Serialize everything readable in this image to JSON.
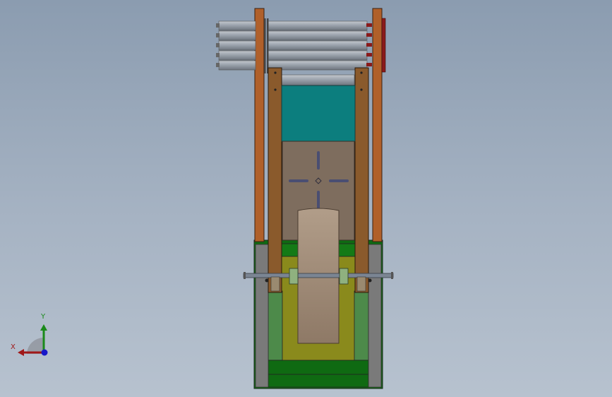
{
  "viewport": {
    "background_top": "#8b9cb0",
    "background_bottom": "#b7c2cf"
  },
  "model": {
    "colors": {
      "roller_gray": "#9aa2ac",
      "frame_brown": "#8a5a2c",
      "rail_orange": "#b0602a",
      "plate_teal": "#0c7e7e",
      "plate_taupe": "#7e6d5e",
      "belt_tan": "#a99583",
      "base_green": "#0f6a12",
      "block_lightgreen": "#4d8a4a",
      "base_olive": "#8a8a1c",
      "side_gray": "#777777",
      "bracket_green": "#8fb17f",
      "end_cap_red": "#8a1a1a",
      "slot_blue": "#4a4e72"
    }
  },
  "triad": {
    "x_label": "X",
    "y_label": "Y",
    "x_color": "#a01818",
    "y_color": "#1a8a1a",
    "z_color": "#1818c8"
  }
}
